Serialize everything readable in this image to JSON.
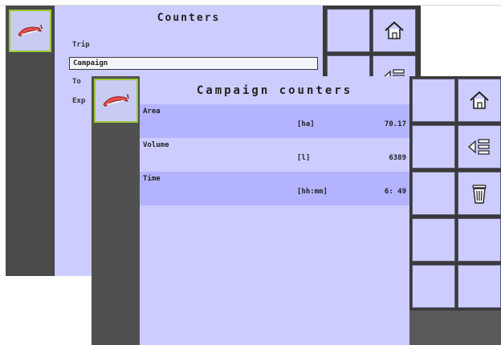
{
  "back_screen": {
    "title": "Counters",
    "items": [
      "Trip",
      "Campaign",
      "To",
      "Exp"
    ],
    "buttons": [
      {
        "icon": "home-icon"
      },
      {
        "icon": "back-arrow-icon"
      }
    ]
  },
  "front_screen": {
    "title": "Campaign counters",
    "rows": [
      {
        "label": "Area",
        "unit": "[ha]",
        "value": "70.17",
        "highlight": true
      },
      {
        "label": "Volume",
        "unit": "[l]",
        "value": "6389",
        "highlight": false
      },
      {
        "label": "Time",
        "unit": "[hh:mm]",
        "value": "6: 49",
        "highlight": true
      }
    ],
    "buttons": [
      {
        "icon": "home-icon"
      },
      {
        "icon": "back-arrow-icon"
      },
      {
        "icon": "trash-icon"
      }
    ]
  },
  "colors": {
    "panel": "#ccccff",
    "highlight_row": "#b3b3ff",
    "frame": "#3a3a3a",
    "logo_border": "#9acb32"
  }
}
